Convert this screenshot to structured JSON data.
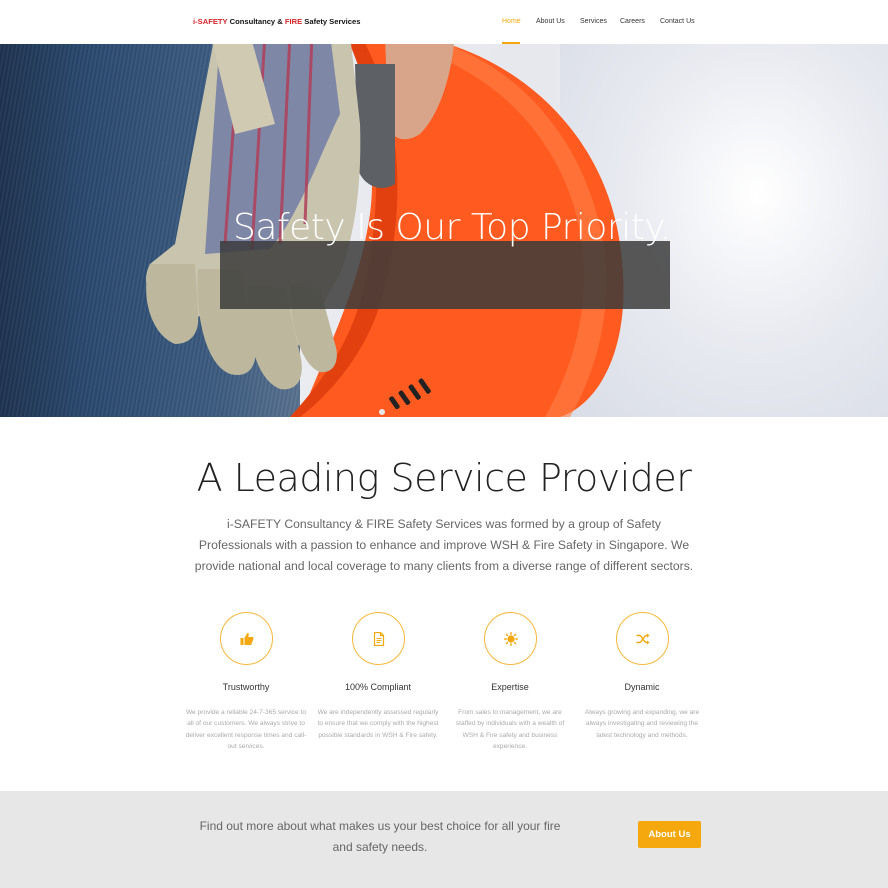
{
  "logo": {
    "prefix": "i-SAFETY",
    "middle": " Consultancy & ",
    "fire": "FIRE",
    "suffix": " Safety Services"
  },
  "nav": {
    "items": [
      {
        "label": "Home",
        "active": true
      },
      {
        "label": "About Us"
      },
      {
        "label": "Services"
      },
      {
        "label": "Careers"
      },
      {
        "label": "Contact Us"
      }
    ]
  },
  "hero": {
    "headline": "Safety Is Our Top Priority."
  },
  "intro": {
    "title": "A Leading Service Provider",
    "text": "i-SAFETY Consultancy & FIRE Safety Services was formed  by a group of Safety Professionals with a passion to enhance and improve WSH & Fire Safety in Singapore. We provide national and local coverage to many clients from a diverse range of different sectors."
  },
  "features": [
    {
      "icon": "thumbs-up-icon",
      "title": "Trustworthy",
      "desc": "We provide a reliable 24-7-365 service to all of our customers. We always strive to deliver excellent response times and call-out services."
    },
    {
      "icon": "document-icon",
      "title": "100% Compliant",
      "desc": "We are independently assessed regularly to ensure that we comply with the highest possible standards in WSH & Fire safety."
    },
    {
      "icon": "sun-icon",
      "title": "Expertise",
      "desc": "From sales to management, we are staffed by individuals with a wealth of WSH & Fire safety and business experience."
    },
    {
      "icon": "shuffle-icon",
      "title": "Dynamic",
      "desc": "Always growing and expanding, we are always investigating and reviewing the latest technology and methods."
    }
  ],
  "cta": {
    "text": "Find out more about what makes us your best choice for all your fire and safety needs.",
    "button": "About Us"
  },
  "colors": {
    "accent": "#f5a80d",
    "logo_red": "#d8232a",
    "helmet": "#ff5a1f",
    "cta_bg": "#e7e7e7"
  }
}
